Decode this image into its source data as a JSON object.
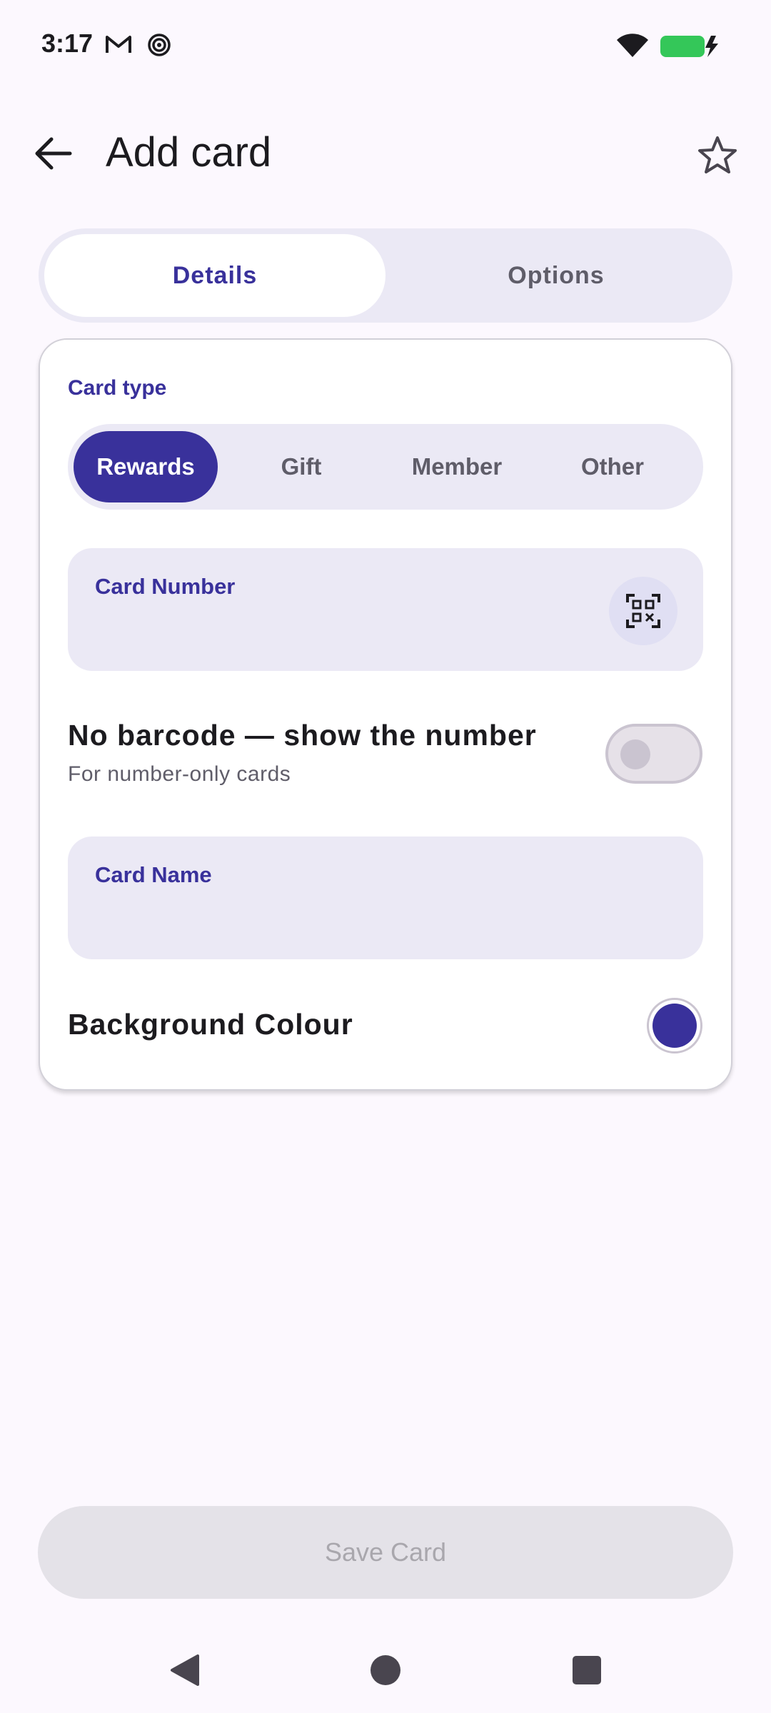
{
  "status_bar": {
    "time": "3:17",
    "icons": [
      "gmail-icon",
      "spiral-notification-icon",
      "wifi-icon",
      "battery-charging-icon"
    ],
    "battery_level": 0.9,
    "battery_color": "#34c759"
  },
  "app_bar": {
    "title": "Add card",
    "back_icon": "arrow-left-icon",
    "favorite_icon": "star-outline-icon"
  },
  "tabs": [
    {
      "label": "Details",
      "selected": true
    },
    {
      "label": "Options",
      "selected": false
    }
  ],
  "card_form": {
    "card_type": {
      "label": "Card type",
      "options": [
        "Rewards",
        "Gift",
        "Member",
        "Other"
      ],
      "selected": "Rewards"
    },
    "card_number": {
      "label": "Card Number",
      "value": "",
      "scan_icon": "qr-scan-icon"
    },
    "no_barcode": {
      "title": "No barcode — show the number",
      "subtitle": "For number-only cards",
      "enabled": false
    },
    "card_name": {
      "label": "Card Name",
      "value": ""
    },
    "background_colour": {
      "label": "Background Colour",
      "color": "#39319b"
    }
  },
  "save_button": {
    "label": "Save Card",
    "enabled": false
  },
  "theme": {
    "accent": "#39319b",
    "surface": "#fcf8fe",
    "container": "#ebe9f5"
  },
  "nav_bar": [
    "back-triangle-icon",
    "home-circle-icon",
    "recents-square-icon"
  ]
}
